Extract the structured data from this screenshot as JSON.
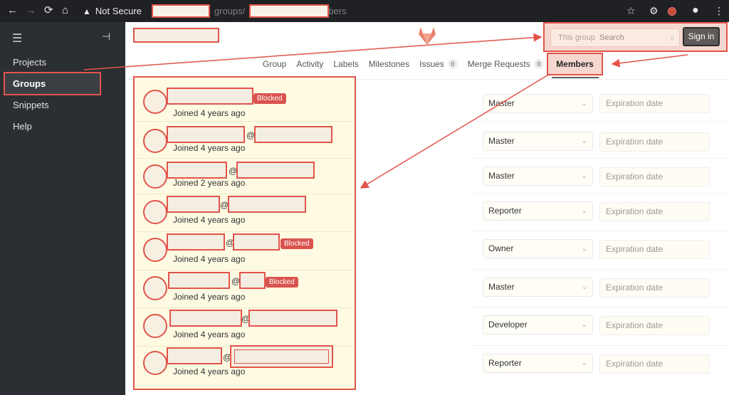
{
  "browser": {
    "security_label": "Not Secure",
    "url_seg1": "groups/",
    "url_seg2": "bers"
  },
  "sidebar": {
    "items": [
      {
        "label": "Projects"
      },
      {
        "label": "Groups"
      },
      {
        "label": "Snippets"
      },
      {
        "label": "Help"
      }
    ]
  },
  "header": {
    "search_scope": "This group",
    "search_placeholder": "Search",
    "signin_label": "Sign in"
  },
  "tabs": [
    {
      "label": "Group"
    },
    {
      "label": "Activity"
    },
    {
      "label": "Labels"
    },
    {
      "label": "Milestones"
    },
    {
      "label": "Issues",
      "count": "0"
    },
    {
      "label": "Merge Requests",
      "count": "0"
    },
    {
      "label": "Members"
    }
  ],
  "members": [
    {
      "joined": "Joined 4 years ago",
      "role": "Master",
      "blocked": "Blocked"
    },
    {
      "joined": "Joined 4 years ago",
      "role": "Master"
    },
    {
      "joined": "Joined 2 years ago",
      "role": "Master"
    },
    {
      "joined": "Joined 4 years ago",
      "role": "Reporter"
    },
    {
      "joined": "Joined 4 years ago",
      "role": "Owner",
      "blocked": "Blocked"
    },
    {
      "joined": "Joined 4 years ago",
      "role": "Master",
      "blocked": "Blocked"
    },
    {
      "joined": "Joined 4 years ago",
      "role": "Developer"
    },
    {
      "joined": "Joined 4 years ago",
      "role": "Reporter"
    }
  ],
  "member_at_sign": "@",
  "expiration_placeholder": "Expiration date",
  "colors": {
    "annotation_red": "#e2544a",
    "sidebar_bg": "#2b2f33",
    "highlight_yellow": "#fffbe3",
    "blocked_badge": "#d9534f"
  }
}
